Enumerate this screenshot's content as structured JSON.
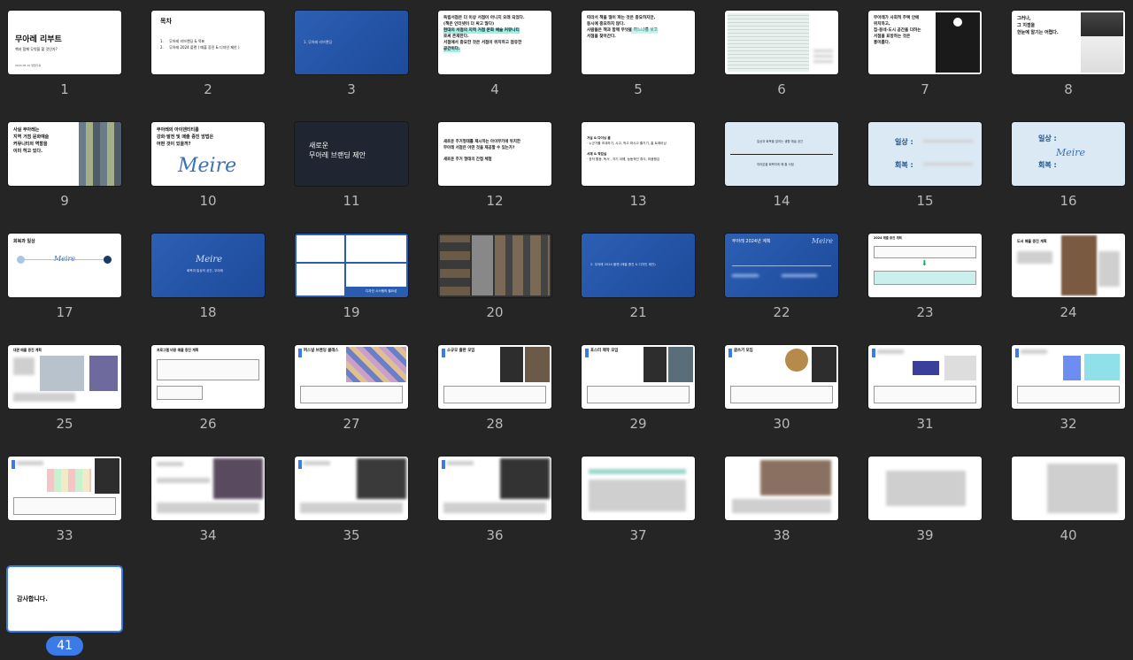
{
  "slides": [
    {
      "n": "1",
      "title": "무아레 리부트",
      "sub": "책과 함께 무엇을 할 것인가?",
      "foot": "2024.05.10 영업기획"
    },
    {
      "n": "2",
      "title": "목차",
      "items": [
        "1.     무아레 리브랜딩 & 목표",
        "2.     무아레 2024 플랜 ( 매출 증진 & 디자인 제안 )"
      ]
    },
    {
      "n": "3",
      "text": "1. 무아레 리브랜딩"
    },
    {
      "n": "4",
      "lines": [
        "독립서점은 더 이상 서점이 아니지 오래 되었다.",
        "(책은 인터넷이 더 싸고 많다)",
        "현대의 서점의 지역 거점 문화 예술 커뮤니티",
        "로써 존재한다.",
        "서점에서 중요한 것은 서점이 위치하고 점유한",
        "공간이다."
      ]
    },
    {
      "n": "5",
      "lines": [
        "따라서 책을 많이 파는 것은 중요하지만,",
        "동시에 중요하지 않다.",
        "사람들은 책과 함께 무엇을 파느냐를 보고",
        "서점을 찾아간다."
      ]
    },
    {
      "n": "6"
    },
    {
      "n": "7",
      "lines": [
        "무아레가 사회적 주택 안에",
        "위치하고,",
        "집-동네-도시 공간을 더하는",
        "서점을 표방하는 것은",
        "흥미롭다."
      ]
    },
    {
      "n": "8",
      "lines": [
        "그러나,",
        "그 지점을",
        "한눈에 알기는 어렵다."
      ]
    },
    {
      "n": "9",
      "lines": [
        "사실 무아레는",
        "지역 거점 문화예술",
        "커뮤니티의 역할을",
        "이미 하고 있다."
      ]
    },
    {
      "n": "10",
      "lines": [
        "무아레의 아이덴티티를",
        "강화·발전 및 매출 증진 방법은",
        "어떤 것이 있을까?"
      ],
      "logo": "Meire"
    },
    {
      "n": "11",
      "lines": [
        "새로운",
        "무아레 브랜딩 제안"
      ]
    },
    {
      "n": "12",
      "lines": [
        "새로운 주거형태를 제시하는 아이부키에 위치한",
        "무아레 서점은 어떤 것을 제공할 수 있는가?",
        "",
        "새로운 주거 형태의 간접 체험"
      ]
    },
    {
      "n": "13",
      "lines": [
        "거실 & 다이닝 룸",
        "· 누군가를 초대하기, 시고, 먹고 마시고 즐기기, 홈 트레이닝",
        "",
        "서재 & 작업실",
        "· 창작 활동, 독서 , 자기 이해, 능동적인 휴식, 마음챙김"
      ]
    },
    {
      "n": "14",
      "lines": [
        "일상과 회복을 말하는 생활 예술 공간",
        "여러분을 회복하게 해 줄 서점"
      ]
    },
    {
      "n": "15",
      "k1": "일상 :",
      "k2": "회복 :"
    },
    {
      "n": "16",
      "k1": "일상 :",
      "k2": "회복 :",
      "logo": "Meire"
    },
    {
      "n": "17",
      "title": "회복과 일상",
      "logo": "Meire"
    },
    {
      "n": "18",
      "logo": "Meire",
      "sub": "회복과 일상의 공간, 무아레"
    },
    {
      "n": "19",
      "caption": "디자인 시스템의 필요성"
    },
    {
      "n": "20"
    },
    {
      "n": "21",
      "text": "2. 무아레 2024 플랜 (매출 증진 & 디자인 제안)"
    },
    {
      "n": "22",
      "title": "무아레 2024년 계획",
      "logo": "Meire"
    },
    {
      "n": "23",
      "title": "2024 매출 증진 계획"
    },
    {
      "n": "24",
      "title": "도서 매출 증진 계획"
    },
    {
      "n": "25",
      "title": "대관 매출 증진 계획"
    },
    {
      "n": "26",
      "title": "프로그램 비용 매출 증진 계획"
    },
    {
      "n": "27",
      "title": "퍼스널 브랜딩 클래스"
    },
    {
      "n": "28",
      "title": "소규모 출판 모임"
    },
    {
      "n": "29",
      "title": "포스터 제작 모임"
    },
    {
      "n": "30",
      "title": "글쓰기 모임"
    },
    {
      "n": "31"
    },
    {
      "n": "32"
    },
    {
      "n": "33"
    },
    {
      "n": "34"
    },
    {
      "n": "35"
    },
    {
      "n": "36"
    },
    {
      "n": "37"
    },
    {
      "n": "38"
    },
    {
      "n": "39"
    },
    {
      "n": "40"
    },
    {
      "n": "41",
      "title": "감사합니다."
    }
  ]
}
